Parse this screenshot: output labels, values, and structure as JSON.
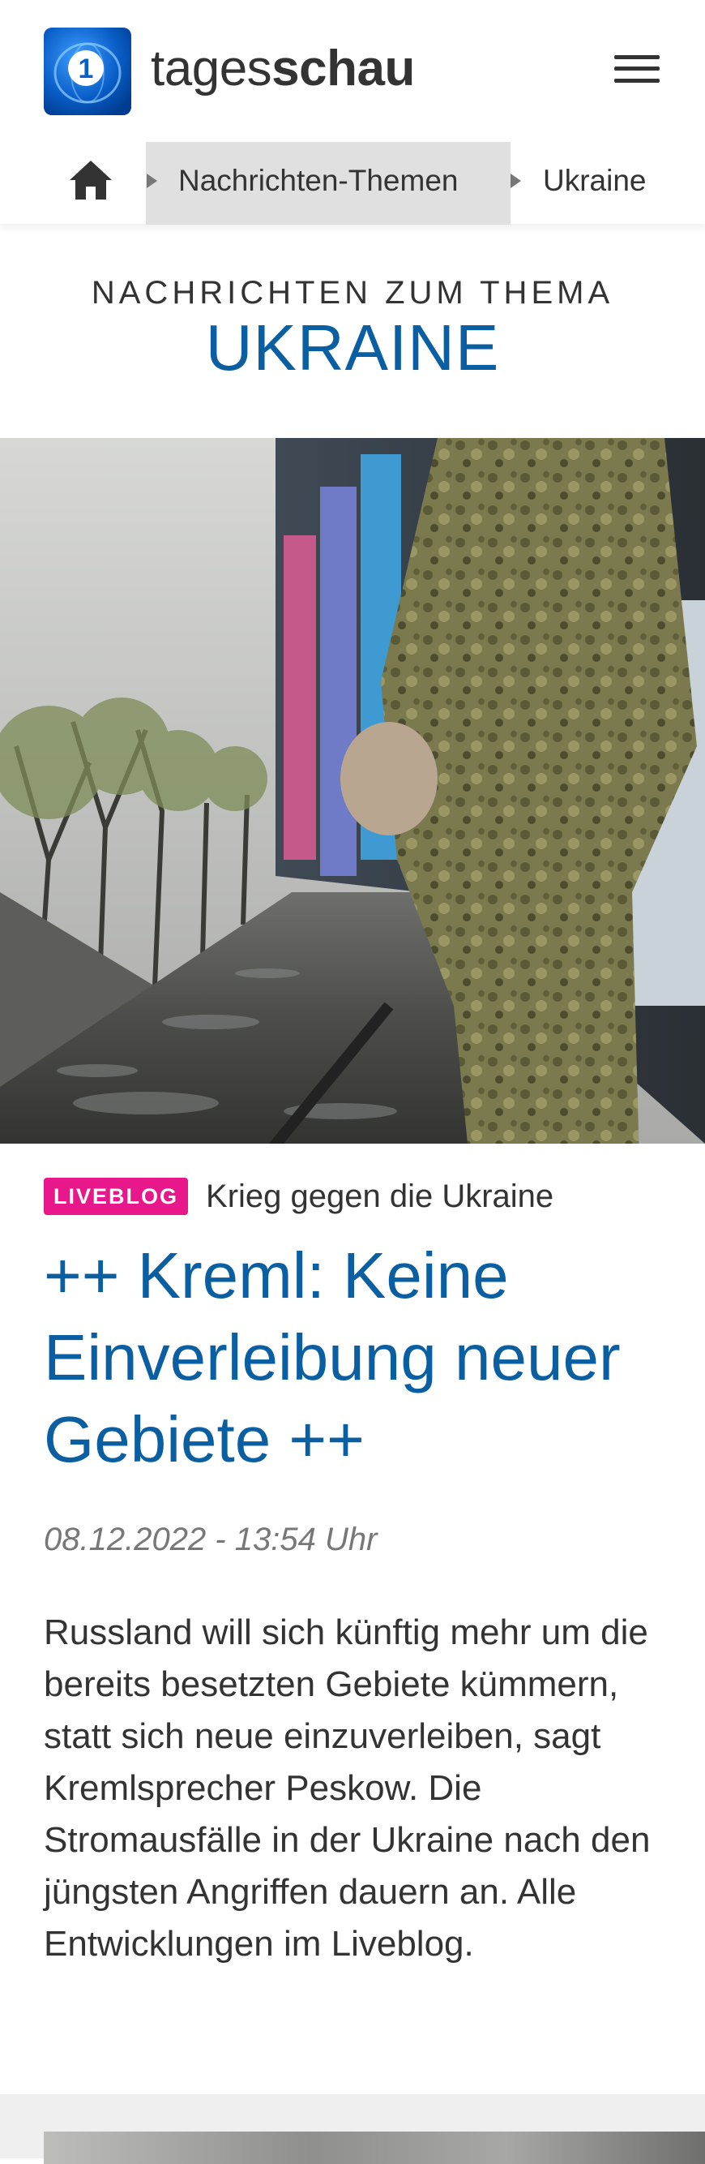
{
  "header": {
    "brand_light": "tages",
    "brand_bold": "schau",
    "logo_icon": "tagesschau-logo-icon",
    "menu_icon": "hamburger-menu-icon"
  },
  "breadcrumb": {
    "home_icon": "home-icon",
    "items": [
      {
        "label": "Nachrichten-Themen",
        "active": true
      },
      {
        "label": "Ukraine",
        "active": false
      }
    ]
  },
  "topic": {
    "subtitle": "NACHRICHTEN ZUM THEMA",
    "title": "UKRAINE"
  },
  "teaser": {
    "badge": "LIVEBLOG",
    "topline": "Krieg gegen die Ukraine",
    "headline": "++ Kreml: Keine Einverleibung neuer Gebiete ++",
    "date": "08.12.2022 - 13:54 Uhr",
    "shorttext": "Russland will sich künftig mehr um die bereits besetzten Gebiete kümmern, statt sich neue einzuverleiben, sagt Kremlsprecher Peskow. Die Stromausfälle in der Ukraine nach den jüngsten Angriffen dauern an. Alle Entwicklungen im Liveblog."
  },
  "colors": {
    "accent_blue": "#0a5ea2",
    "live_pink": "#e8188a",
    "text_dark": "#333333",
    "text_grey": "#777777"
  }
}
